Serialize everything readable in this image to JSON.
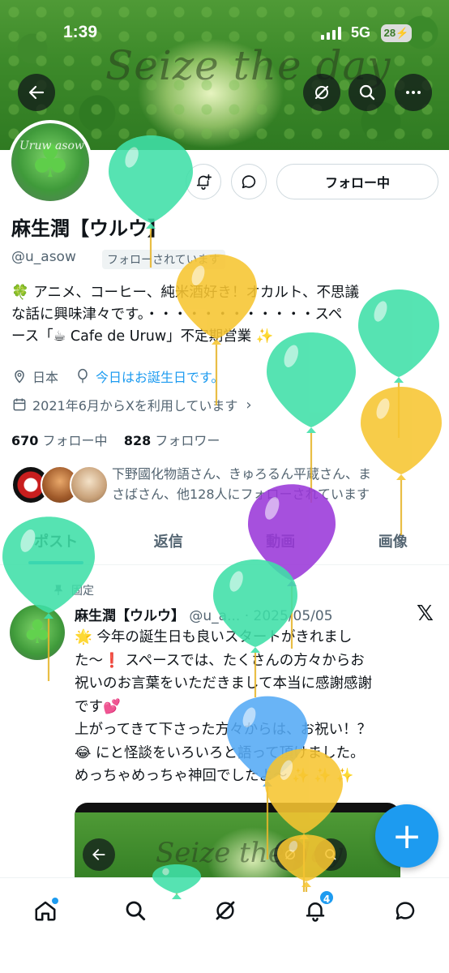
{
  "status_bar": {
    "time": "1:39",
    "network": "5G",
    "battery": "28"
  },
  "banner": {
    "motto": "Seize the day"
  },
  "profile": {
    "avatar_text": "Uruw asow",
    "name": "麻生潤【ウルウ】",
    "handle": "@u_asow",
    "follows_you": "フォローされています",
    "follow_button": "フォロー中",
    "bio_line1": "🍀 アニメ、コーヒー、純米酒好き！オカルト、不思議",
    "bio_line2": "な話に興味津々です。・・・・・・・・・・・・スペ",
    "bio_line3": "ース「☕ Cafe de Uruw」不定期営業 ✨",
    "location": "日本",
    "birthday": "今日はお誕生日です。",
    "joined": "2021年6月からXを利用しています",
    "following_count": "670",
    "following_label": "フォロー中",
    "followers_count": "828",
    "followers_label": "フォロワー",
    "known_followers_line1": "下野國化物語さん、きゅろるん平蔵さん、ま",
    "known_followers_line2": "さばさん、他128人にフォローされています"
  },
  "tabs": [
    {
      "label": "ポスト",
      "active": true
    },
    {
      "label": "返信",
      "active": false
    },
    {
      "label": "動画",
      "active": false
    },
    {
      "label": "画像",
      "active": false
    }
  ],
  "post": {
    "pinned_label": "固定",
    "author": "麻生潤【ウルウ】",
    "meta": "@u_a... · 2025/05/05",
    "line1": "🌟 今年の誕生日も良いスタートがきれまし",
    "line2": "た〜❗ スペースでは、たくさんの方々からお",
    "line3": "祝いのお言葉をいただきまして本当に感謝感謝",
    "line4": "です💕",
    "line5": "上がってきて下さった方々からは、お祝い！？",
    "line6": "😂 にと怪談をいろいろと語って頂けました。",
    "line7": "めっちゃめっちゃ神回でしたよ〜 ✨ ✨ ✨",
    "media_motto": "Seize the day"
  },
  "fab": {
    "label": "+"
  },
  "nav": {
    "notifications_badge": "4"
  },
  "colors": {
    "accent": "#1d9bf0",
    "balloon_green": "#3fe0a8",
    "balloon_yellow": "#f7c531",
    "balloon_purple": "#9a38d9",
    "balloon_blue": "#55aaf5"
  }
}
